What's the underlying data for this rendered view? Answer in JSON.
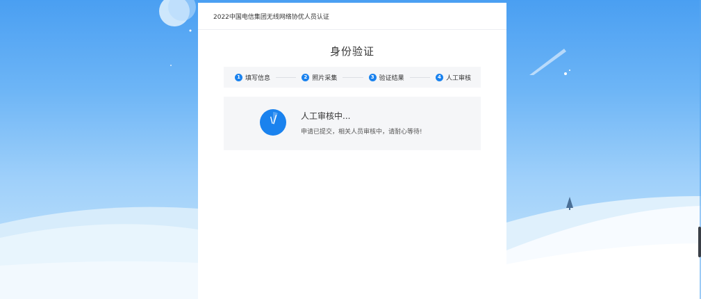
{
  "header": {
    "title": "2022中国电信集团无线网络协优人员认证"
  },
  "page": {
    "title": "身份验证"
  },
  "steps": [
    {
      "num": "1",
      "label": "填写信息"
    },
    {
      "num": "2",
      "label": "照片采集"
    },
    {
      "num": "3",
      "label": "验证结果"
    },
    {
      "num": "4",
      "label": "人工审核"
    }
  ],
  "status": {
    "title": "人工审核中...",
    "description": "申请已提交，相关人员审核中，请耐心等待!",
    "icon": "clock-icon"
  },
  "colors": {
    "accent": "#1a82ee",
    "sky_top": "#4a9ff2",
    "panel_bg": "#ffffff",
    "card_bg": "#f5f6f8"
  }
}
